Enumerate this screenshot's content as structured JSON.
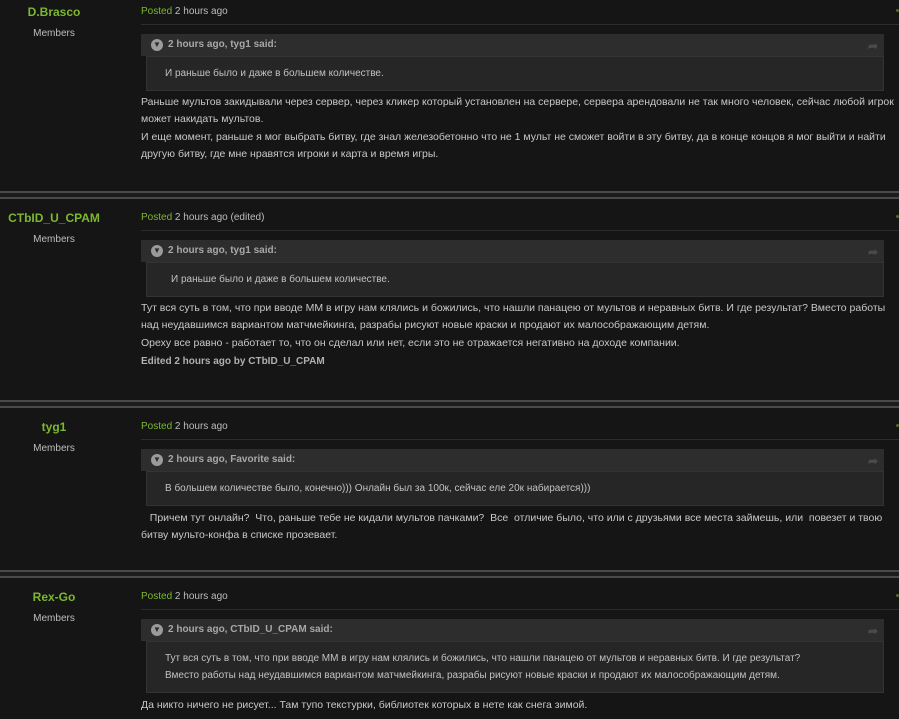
{
  "posts": [
    {
      "author": "D.Brasco",
      "group": "Members",
      "posted_label": "Posted",
      "time": "2 hours ago",
      "edited_flag": "",
      "quote_header": "2 hours ago, tyg1 said:",
      "quote_lines": [
        "И раньше было и даже в большем количестве."
      ],
      "paragraphs": [
        "Раньше мультов закидывали через сервер, через кликер который установлен на сервере, сервера арендовали не так много человек, сейчас любой игрок может накидать мультов.",
        "И еще момент, раньше я мог выбрать битву, где знал железобетонно что не 1 мульт не сможет войти в эту битву, да в конце концов я мог выйти и найти другую битву, где мне нравятся игроки и карта и время игры."
      ],
      "edited_note": ""
    },
    {
      "author": "CTbID_U_CPAM",
      "group": "Members",
      "posted_label": "Posted",
      "time": "2 hours ago",
      "edited_flag": "(edited)",
      "quote_header": "2 hours ago, tyg1 said:",
      "quote_lines": [
        "И раньше было и даже в большем количестве."
      ],
      "paragraphs": [
        "Тут вся суть в том, что при вводе ММ в игру нам клялись и божились, что нашли панацею от мультов и неравных битв. И где результат? Вместо работы над неудавшимся вариантом матчмейкинга, разрабы рисуют новые краски и продают их малосображающим детям.",
        "Ореху все равно - работает то, что он сделал или нет, если это не отражается негативно на доходе компании."
      ],
      "edited_note": "Edited 2 hours ago by CTbID_U_CPAM"
    },
    {
      "author": "tyg1",
      "group": "Members",
      "posted_label": "Posted",
      "time": "2 hours ago",
      "edited_flag": "",
      "quote_header": "2 hours ago, Favorite said:",
      "quote_lines": [
        "В большем количестве было, конечно))) Онлайн был за 100к, сейчас еле 20к набирается)))"
      ],
      "paragraphs": [
        "   Причем тут онлайн?  Что, раньше тебе не кидали мультов пачками?  Все  отличие было, что или с друзьями все места займешь, или  повезет и твою битву мульто-конфа в списке прозевает."
      ],
      "edited_note": ""
    },
    {
      "author": "Rex-Go",
      "group": "Members",
      "posted_label": "Posted",
      "time": "2 hours ago",
      "edited_flag": "",
      "quote_header": "2 hours ago, CTbID_U_CPAM said:",
      "quote_lines": [
        "Тут вся суть в том, что при вводе ММ в игру нам клялись и божились, что нашли панацею от мультов и неравных битв. И где результат?",
        "Вместо работы над неудавшимся вариантом матчмейкинга, разрабы рисуют новые краски и продают их малосображающим детям."
      ],
      "paragraphs": [
        "Да никто ничего не рисует... Там тупо текстурки, библиотек которых в нете как снега зимой."
      ],
      "edited_note": ""
    }
  ],
  "colors": {
    "accent": "#7cb82f",
    "background": "#151515",
    "quote_bg": "#262626"
  },
  "icons": {
    "quote_toggle": "chevron-down-icon",
    "share": "share-icon"
  }
}
